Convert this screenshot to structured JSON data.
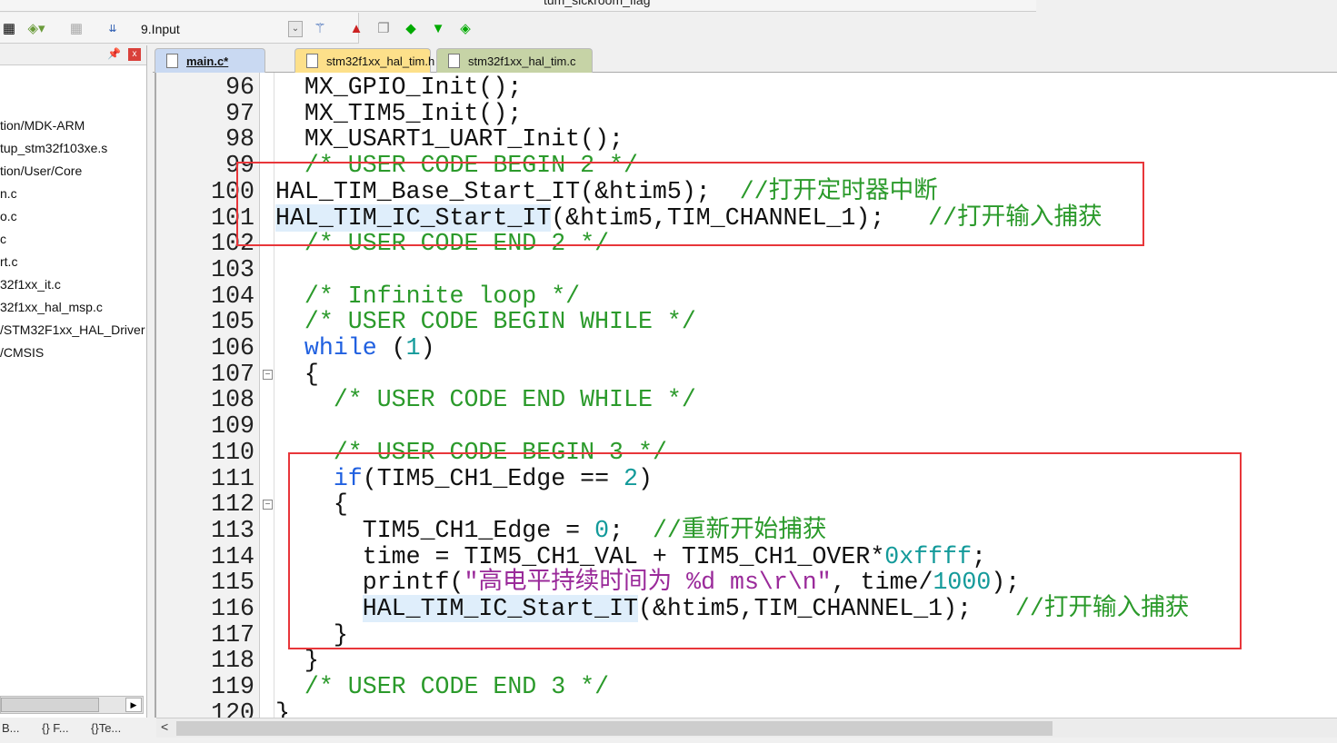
{
  "toolbar": {
    "project_name_partial": "tum_sickroom_flag",
    "target_select": "9.Input"
  },
  "sidebar": {
    "items": [
      "tion/MDK-ARM",
      "tup_stm32f103xe.s",
      "tion/User/Core",
      "n.c",
      "o.c",
      "c",
      "rt.c",
      "32f1xx_it.c",
      "32f1xx_hal_msp.c",
      "/STM32F1xx_HAL_Driver",
      "/CMSIS"
    ],
    "bottom_tabs": [
      "B...",
      "F...",
      "Te..."
    ]
  },
  "tabs": [
    {
      "label": "main.c*",
      "color": "#c9d9f2",
      "active": true
    },
    {
      "label": "stm32f1xx_hal_tim.h",
      "color": "#fde08a"
    },
    {
      "label": "stm32f1xx_hal_tim.c",
      "color": "#c6d3a6"
    }
  ],
  "code": {
    "colors": {
      "comment": "#2b9a2b",
      "keyword": "#2060e0",
      "number": "#139a9a",
      "string": "#9a2a9a",
      "highlight_box": "#e8363a"
    },
    "lines": [
      {
        "n": "96",
        "t": [
          [
            "  MX_GPIO_Init();",
            ""
          ]
        ]
      },
      {
        "n": "97",
        "t": [
          [
            "  MX_TIM5_Init();",
            ""
          ]
        ]
      },
      {
        "n": "98",
        "t": [
          [
            "  MX_USART1_UART_Init();",
            ""
          ]
        ]
      },
      {
        "n": "99",
        "t": [
          [
            "  ",
            ""
          ],
          [
            "/* USER CODE BEGIN 2 */",
            "c"
          ]
        ]
      },
      {
        "n": "100",
        "t": [
          [
            "HAL_TIM_Base_Start_IT(&htim5);  ",
            ""
          ],
          [
            "//打开定时器中断",
            "c"
          ]
        ]
      },
      {
        "n": "101",
        "t": [
          [
            "HAL_TIM_IC_Start_IT",
            "h"
          ],
          [
            "(&htim5,TIM_CHANNEL_1);   ",
            ""
          ],
          [
            "//打开输入捕获",
            "c"
          ]
        ]
      },
      {
        "n": "102",
        "t": [
          [
            "  ",
            ""
          ],
          [
            "/* USER CODE END 2 */",
            "c"
          ]
        ]
      },
      {
        "n": "103",
        "t": []
      },
      {
        "n": "104",
        "t": [
          [
            "  ",
            ""
          ],
          [
            "/* Infinite loop */",
            "c"
          ]
        ]
      },
      {
        "n": "105",
        "t": [
          [
            "  ",
            ""
          ],
          [
            "/* USER CODE BEGIN WHILE */",
            "c"
          ]
        ]
      },
      {
        "n": "106",
        "t": [
          [
            "  ",
            ""
          ],
          [
            "while",
            "k"
          ],
          [
            " (",
            ""
          ],
          [
            "1",
            "n"
          ],
          [
            ")",
            ""
          ]
        ]
      },
      {
        "n": "107",
        "t": [
          [
            "  {",
            ""
          ]
        ],
        "fold": true
      },
      {
        "n": "108",
        "t": [
          [
            "    ",
            ""
          ],
          [
            "/* USER CODE END WHILE */",
            "c"
          ]
        ]
      },
      {
        "n": "109",
        "t": []
      },
      {
        "n": "110",
        "t": [
          [
            "    ",
            ""
          ],
          [
            "/* USER CODE BEGIN 3 */",
            "c"
          ]
        ]
      },
      {
        "n": "111",
        "t": [
          [
            "    ",
            ""
          ],
          [
            "if",
            "k"
          ],
          [
            "(TIM5_CH1_Edge == ",
            ""
          ],
          [
            "2",
            "n"
          ],
          [
            ")",
            ""
          ]
        ]
      },
      {
        "n": "112",
        "t": [
          [
            "    {",
            ""
          ]
        ],
        "fold": true
      },
      {
        "n": "113",
        "t": [
          [
            "      TIM5_CH1_Edge = ",
            ""
          ],
          [
            "0",
            "n"
          ],
          [
            ";  ",
            ""
          ],
          [
            "//重新开始捕获",
            "c"
          ]
        ]
      },
      {
        "n": "114",
        "t": [
          [
            "      time = TIM5_CH1_VAL + TIM5_CH1_OVER*",
            ""
          ],
          [
            "0xffff",
            "n"
          ],
          [
            ";",
            ""
          ]
        ]
      },
      {
        "n": "115",
        "t": [
          [
            "      printf(",
            ""
          ],
          [
            "\"高电平持续时间为 %d ms\\r\\n\"",
            "s"
          ],
          [
            ", time/",
            ""
          ],
          [
            "1000",
            "n"
          ],
          [
            ");",
            ""
          ]
        ]
      },
      {
        "n": "116",
        "t": [
          [
            "      ",
            ""
          ],
          [
            "HAL_TIM_IC_Start_IT",
            "h"
          ],
          [
            "(&htim5,TIM_CHANNEL_1);   ",
            ""
          ],
          [
            "//打开输入捕获",
            "c"
          ]
        ]
      },
      {
        "n": "117",
        "t": [
          [
            "    }",
            ""
          ]
        ]
      },
      {
        "n": "118",
        "t": [
          [
            "  }",
            ""
          ]
        ]
      },
      {
        "n": "119",
        "t": [
          [
            "  ",
            ""
          ],
          [
            "/* USER CODE END 3 */",
            "c"
          ]
        ]
      },
      {
        "n": "120",
        "t": [
          [
            "}",
            ""
          ]
        ]
      }
    ]
  }
}
